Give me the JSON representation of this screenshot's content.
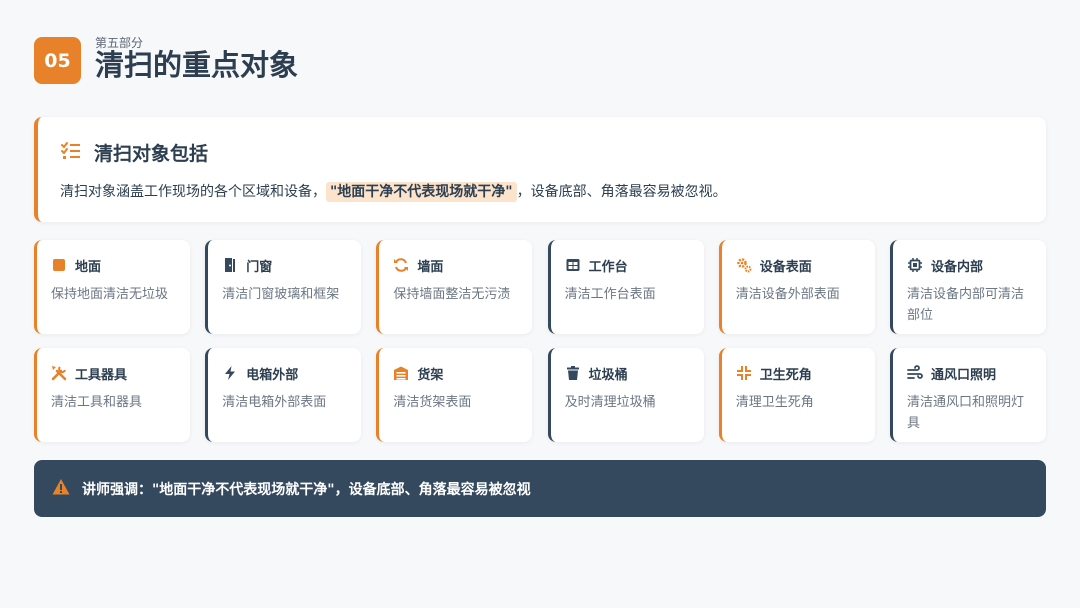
{
  "header": {
    "badge": "05",
    "subtitle": "第五部分",
    "title": "清扫的重点对象"
  },
  "intro": {
    "title": "清扫对象包括",
    "text_before": "清扫对象涵盖工作现场的各个区域和设备，",
    "highlight": "\"地面干净不代表现场就干净\"",
    "text_after": "，设备底部、角落最容易被忽视。",
    "icon": "list-check-icon"
  },
  "cards": [
    {
      "title": "地面",
      "desc": "保持地面清洁无垃圾",
      "icon": "square-icon",
      "accent": "orange"
    },
    {
      "title": "门窗",
      "desc": "清洁门窗玻璃和框架",
      "icon": "door-icon",
      "accent": "navy"
    },
    {
      "title": "墙面",
      "desc": "保持墙面整洁无污渍",
      "icon": "refresh-icon",
      "accent": "orange"
    },
    {
      "title": "工作台",
      "desc": "清洁工作台表面",
      "icon": "table-icon",
      "accent": "navy"
    },
    {
      "title": "设备表面",
      "desc": "清洁设备外部表面",
      "icon": "gears-icon",
      "accent": "orange"
    },
    {
      "title": "设备内部",
      "desc": "清洁设备内部可清洁部位",
      "icon": "chip-icon",
      "accent": "navy"
    },
    {
      "title": "工具器具",
      "desc": "清洁工具和器具",
      "icon": "tools-icon",
      "accent": "orange"
    },
    {
      "title": "电箱外部",
      "desc": "清洁电箱外部表面",
      "icon": "bolt-icon",
      "accent": "navy"
    },
    {
      "title": "货架",
      "desc": "清洁货架表面",
      "icon": "warehouse-icon",
      "accent": "orange"
    },
    {
      "title": "垃圾桶",
      "desc": "及时清理垃圾桶",
      "icon": "trash-icon",
      "accent": "navy"
    },
    {
      "title": "卫生死角",
      "desc": "清理卫生死角",
      "icon": "compress-icon",
      "accent": "orange"
    },
    {
      "title": "通风口照明",
      "desc": "清洁通风口和照明灯具",
      "icon": "wind-icon",
      "accent": "navy"
    }
  ],
  "banner": {
    "text": "讲师强调：\"地面干净不代表现场就干净\"，设备底部、角落最容易被忽视",
    "icon": "warning-icon"
  },
  "colors": {
    "accent": "#e8822a",
    "navy": "#34495e",
    "highlight_bg": "#fbe3cc"
  }
}
